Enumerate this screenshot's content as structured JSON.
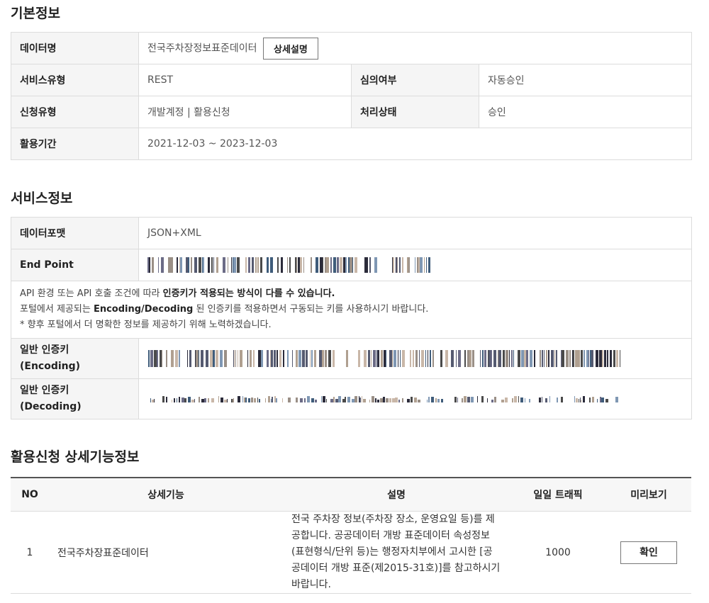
{
  "basic": {
    "title": "기본정보",
    "data_name_label": "데이터명",
    "data_name_value": "전국주차장정보표준데이터",
    "detail_button": "상세설명",
    "service_type_label": "서비스유형",
    "service_type_value": "REST",
    "review_label": "심의여부",
    "review_value": "자동승인",
    "request_type_label": "신청유형",
    "request_type_value": "개발계정 | 활용신청",
    "status_label": "처리상태",
    "status_value": "승인",
    "period_label": "활용기간",
    "period_value": "2021-12-03 ~ 2023-12-03"
  },
  "service": {
    "title": "서비스정보",
    "format_label": "데이터포맷",
    "format_value": "JSON+XML",
    "endpoint_label": "End Point",
    "notice_line1_a": "API 환경 또는 API 호출 조건에 따라 ",
    "notice_line1_b": "인증키가 적용되는 방식이 다를 수 있습니다.",
    "notice_line2_a": "포털에서 제공되는 ",
    "notice_line2_b": "Encoding/Decoding",
    "notice_line2_c": " 된 인증키를 적용하면서 구동되는 키를 사용하시기 바랍니다.",
    "notice_line3": "* 향후 포털에서 더 명확한 정보를 제공하기 위해 노력하겠습니다.",
    "enc_label_1": "일반 인증키",
    "enc_label_2": "(Encoding)",
    "dec_label_1": "일반 인증키",
    "dec_label_2": "(Decoding)"
  },
  "features": {
    "title": "활용신청 상세기능정보",
    "headers": {
      "no": "NO",
      "feature": "상세기능",
      "desc": "설명",
      "traffic": "일일 트래픽",
      "preview": "미리보기"
    },
    "rows": [
      {
        "no": "1",
        "feature": "전국주차장표준데이터",
        "desc_lines": [
          "전국 주차장 정보(주차장 장소, 운영요일 등)를 제",
          "공합니다. 공공데이터 개방 표준데이터 속성정보",
          "(표현형식/단위 등)는 행정자치부에서 고시한 [공",
          "공데이터 개방 표준(제2015-31호)]를 참고하시기",
          "바랍니다."
        ],
        "traffic": "1000",
        "preview_button": "확인"
      }
    ]
  }
}
